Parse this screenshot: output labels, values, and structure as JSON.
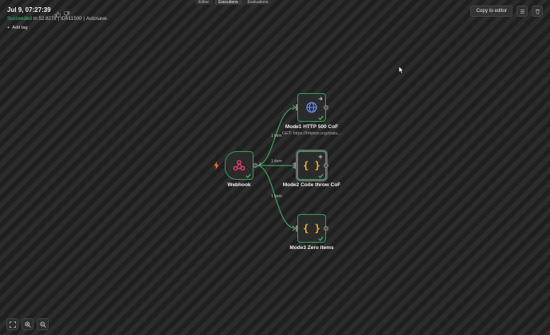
{
  "tabs": [
    "Editor",
    "Executions",
    "Evaluations"
  ],
  "header": {
    "title": "Jul 9, 07:27:39",
    "status": "Succeeded",
    "duration": "in 52.827s",
    "separator": "|",
    "id": "ID#11500",
    "mode": "Autosave",
    "add_tag": "Add tag"
  },
  "toolbar": {
    "copy_label": "Copy to editor"
  },
  "colors": {
    "success": "#3ec46d",
    "node_border": "#3b9c57",
    "webhook": "#e8436a",
    "http": "#6a8dff",
    "code": "#f0b429",
    "trigger_bolt": "#ff6d2d"
  },
  "nodes": {
    "webhook": {
      "label": "Webhook",
      "icon": "webhook-icon"
    },
    "http": {
      "label": "Mode1 HTTP 500 CoF",
      "sub": "GET: https://httpbin.org/statu...",
      "icon": "globe-icon"
    },
    "code_throw": {
      "label": "Mode2 Code throw CoF",
      "icon": "code-braces-icon"
    },
    "zero_items": {
      "label": "Mode3 Zero items",
      "icon": "code-braces-icon"
    }
  },
  "edges": {
    "to_http": "1 item",
    "to_code": "1 item",
    "to_zero": "1 item",
    "branch": "4"
  }
}
